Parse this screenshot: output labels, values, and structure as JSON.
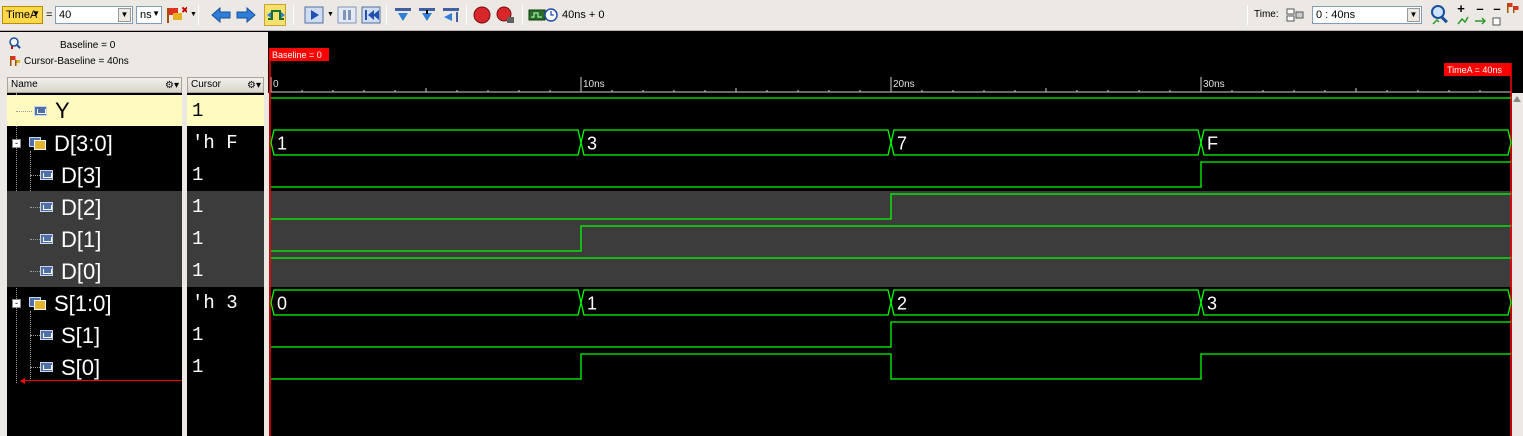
{
  "toolbar": {
    "time_marker_select": "TimeA",
    "equals": "=",
    "time_value": "40",
    "time_unit": "ns",
    "go_time_label": "40ns + 0",
    "time_label": "Time:",
    "time_range": "0 : 40ns"
  },
  "header": {
    "baseline_text": "Baseline = 0",
    "cursor_baseline_text": "Cursor-Baseline = 40ns",
    "col_name": "Name",
    "col_cursor": "Cursor"
  },
  "timeline": {
    "baseline_tag": "Baseline = 0",
    "timea_tag": "TimeA = 40ns",
    "ticks": [
      "0",
      "10ns",
      "20ns",
      "30ns"
    ],
    "max_ns": 40
  },
  "signals": [
    {
      "name": "Y",
      "cursor": "1",
      "kind": "bit",
      "level": 1,
      "edges": [],
      "highlight": true,
      "shade": false
    },
    {
      "name": "D[3:0]",
      "cursor": "'h F",
      "kind": "bus",
      "segments": [
        {
          "t0": 0,
          "t1": 10,
          "v": "1"
        },
        {
          "t0": 10,
          "t1": 20,
          "v": "3"
        },
        {
          "t0": 20,
          "t1": 30,
          "v": "7"
        },
        {
          "t0": 30,
          "t1": 40,
          "v": "F"
        }
      ],
      "shade": false
    },
    {
      "name": "D[3]",
      "cursor": "1",
      "kind": "bit",
      "level": 0,
      "edges": [
        30
      ],
      "shade": false
    },
    {
      "name": "D[2]",
      "cursor": "1",
      "kind": "bit",
      "level": 0,
      "edges": [
        20
      ],
      "shade": true
    },
    {
      "name": "D[1]",
      "cursor": "1",
      "kind": "bit",
      "level": 0,
      "edges": [
        10
      ],
      "shade": true
    },
    {
      "name": "D[0]",
      "cursor": "1",
      "kind": "bit",
      "level": 1,
      "edges": [],
      "shade": true
    },
    {
      "name": "S[1:0]",
      "cursor": "'h 3",
      "kind": "bus",
      "segments": [
        {
          "t0": 0,
          "t1": 10,
          "v": "0"
        },
        {
          "t0": 10,
          "t1": 20,
          "v": "1"
        },
        {
          "t0": 20,
          "t1": 30,
          "v": "2"
        },
        {
          "t0": 30,
          "t1": 40,
          "v": "3"
        }
      ],
      "shade": false
    },
    {
      "name": "S[1]",
      "cursor": "1",
      "kind": "bit",
      "level": 0,
      "edges": [
        20
      ],
      "shade": false
    },
    {
      "name": "S[0]",
      "cursor": "1",
      "kind": "bit",
      "level": 0,
      "edges": [
        10,
        20,
        30
      ],
      "shade": false
    }
  ],
  "colors": {
    "wave": "#00ff00",
    "marker": "#ff0000",
    "row_shade": "#3c3c3c",
    "highlight": "#fffbc0"
  }
}
